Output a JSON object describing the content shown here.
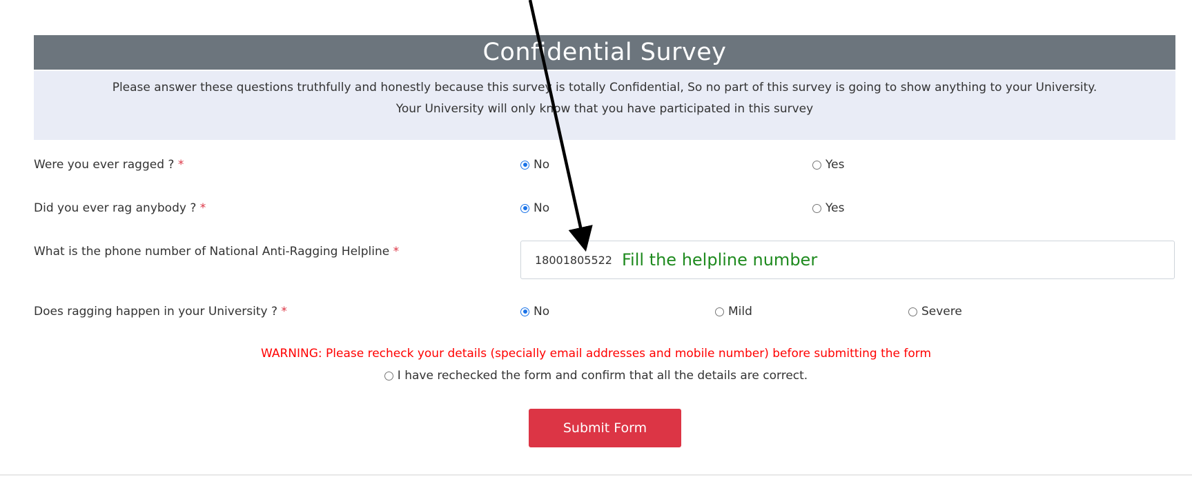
{
  "survey": {
    "title": "Confidential Survey",
    "intro_line1": "Please answer these questions truthfully and honestly because this survey is totally Confidential, So no part of this survey is going to show anything to your University.",
    "intro_line2": "Your University will only know that you have participated in this survey"
  },
  "questions": [
    {
      "label": "Were you ever ragged ?",
      "required_mark": "*",
      "options": [
        {
          "label": "No",
          "checked": true
        },
        {
          "label": "Yes",
          "checked": false
        }
      ]
    },
    {
      "label": "Did you ever rag anybody ?",
      "required_mark": "*",
      "options": [
        {
          "label": "No",
          "checked": true
        },
        {
          "label": "Yes",
          "checked": false
        }
      ]
    },
    {
      "label": "What is the phone number of National Anti-Ragging Helpline",
      "required_mark": "*",
      "value": "18001805522"
    },
    {
      "label": "Does ragging happen in your University ?",
      "required_mark": "*",
      "options": [
        {
          "label": "No",
          "checked": true
        },
        {
          "label": "Mild",
          "checked": false
        },
        {
          "label": "Severe",
          "checked": false
        }
      ]
    }
  ],
  "annotation": {
    "text": "Fill the helpline number",
    "color": "#1e8a1e"
  },
  "warning": {
    "text": "WARNING: Please recheck your details (specially email addresses and mobile number) before submitting the form",
    "color": "#ff0000"
  },
  "confirm": {
    "label": "I have rechecked the form and confirm that all the details are correct.",
    "checked": false
  },
  "submit": {
    "label": "Submit Form",
    "color": "#dc3545"
  },
  "colors": {
    "header_bg": "#6c757d",
    "intro_bg": "#e9ecf6",
    "radio_accent": "#1a73e8"
  }
}
